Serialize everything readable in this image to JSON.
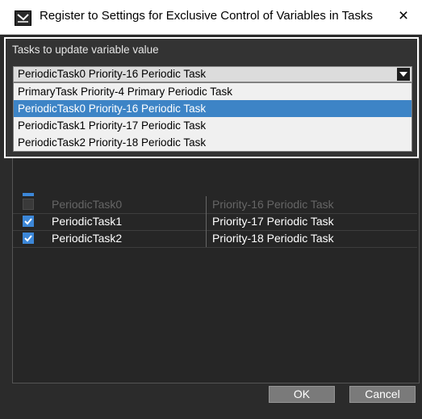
{
  "window": {
    "title": "Register to Settings for Exclusive Control of Variables in Tasks",
    "close_glyph": "×",
    "icon": "app-icon"
  },
  "panel": {
    "label": "Tasks to update variable value",
    "combo_value": "PeriodicTask0 Priority-16 Periodic Task",
    "options": [
      "PrimaryTask Priority-4 Primary Periodic Task",
      "PeriodicTask0 Priority-16 Periodic Task",
      "PeriodicTask1 Priority-17 Periodic Task",
      "PeriodicTask2 Priority-18 Periodic Task"
    ],
    "selected_index": 1
  },
  "table": {
    "rows": [
      {
        "name": "PeriodicTask0",
        "desc": "Priority-16 Periodic Task",
        "checked": false,
        "enabled": false
      },
      {
        "name": "PeriodicTask1",
        "desc": "Priority-17 Periodic Task",
        "checked": true,
        "enabled": true
      },
      {
        "name": "PeriodicTask2",
        "desc": "Priority-18 Periodic Task",
        "checked": true,
        "enabled": true
      }
    ]
  },
  "footer": {
    "ok_label": "OK",
    "cancel_label": "Cancel"
  },
  "colors": {
    "body_bg": "#2b2b2b",
    "selected_option": "#3d84c6",
    "checkbox_checked": "#3c87d8"
  }
}
